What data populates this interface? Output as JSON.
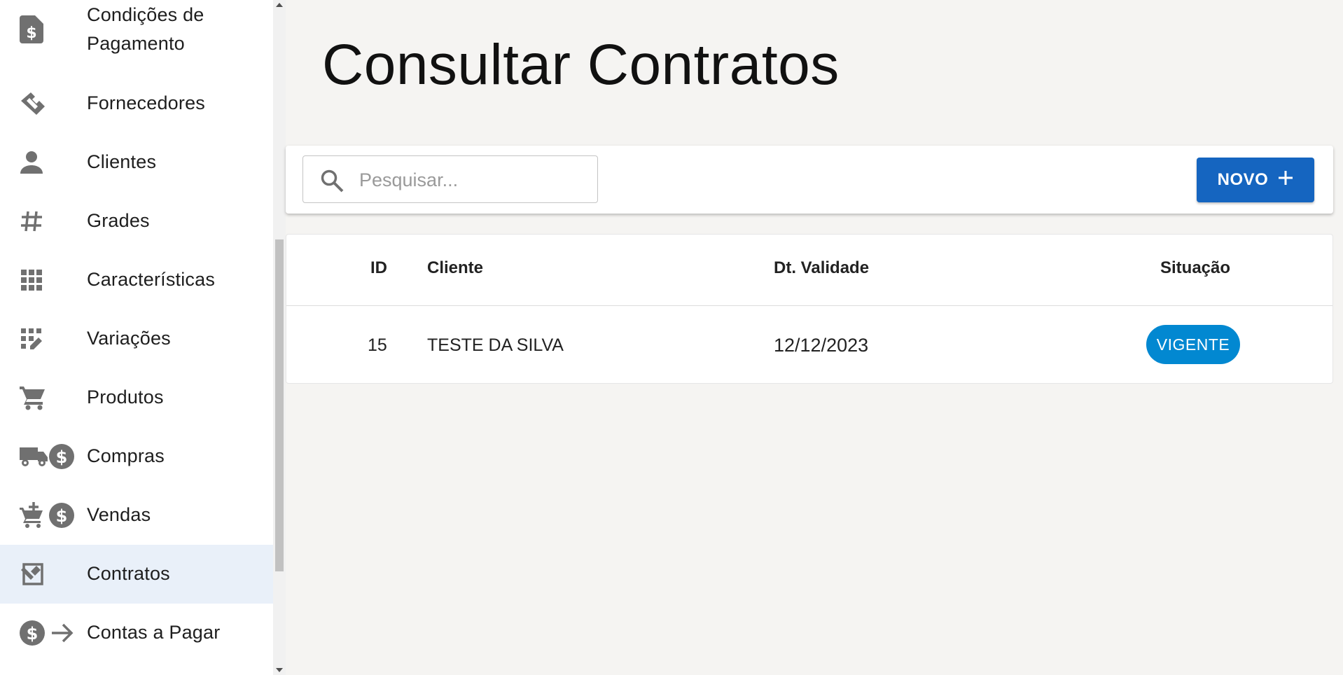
{
  "sidebar": {
    "items": [
      {
        "label_line1": "Condições de",
        "label_line2": "Pagamento",
        "icon": "payment-doc-icon"
      },
      {
        "label": "Fornecedores",
        "icon": "handshake-icon"
      },
      {
        "label": "Clientes",
        "icon": "person-icon"
      },
      {
        "label": "Grades",
        "icon": "hash-icon"
      },
      {
        "label": "Características",
        "icon": "grid-icon"
      },
      {
        "label": "Variações",
        "icon": "grid-edit-icon"
      },
      {
        "label": "Produtos",
        "icon": "cart-icon"
      },
      {
        "label": "Compras",
        "icon": "truck-dollar-icon"
      },
      {
        "label": "Vendas",
        "icon": "cart-add-dollar-icon"
      },
      {
        "label": "Contratos",
        "icon": "contract-icon",
        "active": true
      },
      {
        "label": "Contas a Pagar",
        "icon": "dollar-arrow-icon"
      }
    ]
  },
  "main": {
    "title": "Consultar Contratos",
    "search": {
      "placeholder": "Pesquisar..."
    },
    "new_button": {
      "label": "NOVO"
    },
    "table": {
      "headers": {
        "id": "ID",
        "cliente": "Cliente",
        "validade": "Dt. Validade",
        "situacao": "Situação"
      },
      "rows": [
        {
          "id": "15",
          "cliente": "TESTE DA SILVA",
          "validade": "12/12/2023",
          "situacao": "VIGENTE"
        }
      ]
    }
  },
  "colors": {
    "accent": "#1565c0",
    "status": "#0288d1",
    "active_bg": "#e9f0f9",
    "icon": "#707070"
  }
}
